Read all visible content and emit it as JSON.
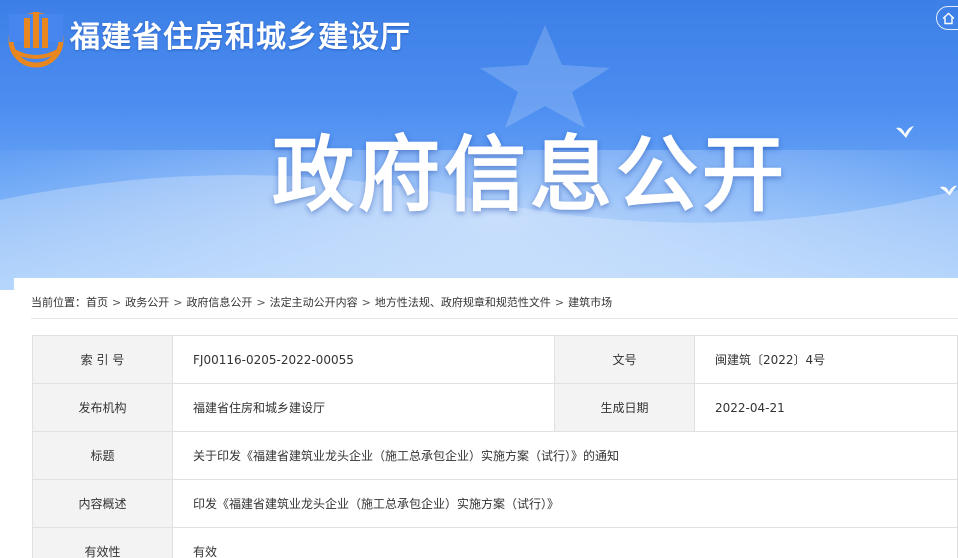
{
  "header": {
    "site_title": "福建省住房和城乡建设厅",
    "banner_title": "政府信息公开",
    "icons": [
      "emblem-logo",
      "home-icon",
      "bird-icon"
    ],
    "colors": {
      "banner_top": "#3c7fe6",
      "banner_bottom": "#9cc8fb",
      "logo_orange": "#e8861f"
    }
  },
  "breadcrumb": {
    "prefix": "当前位置：",
    "items": [
      "首页",
      "政务公开",
      "政府信息公开",
      "法定主动公开内容",
      "地方性法规、政府规章和规范性文件",
      "建筑市场"
    ],
    "separator": ">"
  },
  "info_table": {
    "index_label": "索 引 号",
    "index_value": "FJ00116-0205-2022-00055",
    "doc_no_label": "文号",
    "doc_no_value": "闽建筑〔2022〕4号",
    "publisher_label": "发布机构",
    "publisher_value": "福建省住房和城乡建设厅",
    "date_label": "生成日期",
    "date_value": "2022-04-21",
    "title_label": "标题",
    "title_value": "关于印发《福建省建筑业龙头企业（施工总承包企业）实施方案（试行）》的通知",
    "summary_label": "内容概述",
    "summary_value": "印发《福建省建筑业龙头企业（施工总承包企业）实施方案（试行）》",
    "validity_label": "有效性",
    "validity_value": "有效"
  }
}
